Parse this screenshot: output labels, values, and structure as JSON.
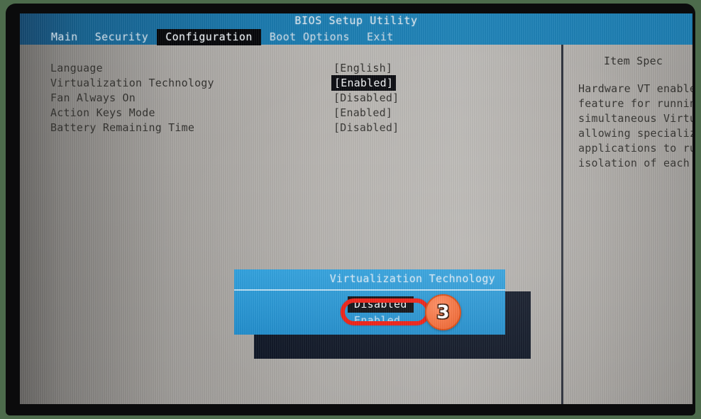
{
  "window": {
    "title": "BIOS Setup Utility"
  },
  "menubar": {
    "items": [
      {
        "label": "Main",
        "active": false
      },
      {
        "label": "Security",
        "active": false
      },
      {
        "label": "Configuration",
        "active": true
      },
      {
        "label": "Boot Options",
        "active": false
      },
      {
        "label": "Exit",
        "active": false
      }
    ]
  },
  "settings": {
    "rows": [
      {
        "label": "Language",
        "value": "[English]",
        "selected": false
      },
      {
        "label": "Virtualization Technology",
        "value": "[Enabled]",
        "selected": true
      },
      {
        "label": "Fan Always On",
        "value": "[Disabled]",
        "selected": false
      },
      {
        "label": "Action Keys Mode",
        "value": "[Enabled]",
        "selected": false
      },
      {
        "label": "Battery Remaining Time",
        "value": "[Disabled]",
        "selected": false
      }
    ]
  },
  "help": {
    "title": "Item Spec",
    "lines": [
      "Hardware VT enable",
      "feature for runnin",
      "simultaneous Virtu",
      "allowing specializ",
      "applications to ru",
      "isolation of each"
    ]
  },
  "dialog": {
    "title": "Virtualization Technology",
    "options": [
      {
        "label": "Disabled",
        "selected": true
      },
      {
        "label": "Enabled",
        "selected": false
      }
    ]
  },
  "annotation": {
    "step_number": "3",
    "ring_color": "#ee1b10",
    "badge_color": "#f7733f"
  },
  "colors": {
    "header_blue": "#1b79ad",
    "dialog_blue": "#2196d8",
    "screen_gray": "#b3b0ac",
    "frame_green": "#4d6b4c",
    "highlight_black": "#0a0b10"
  }
}
